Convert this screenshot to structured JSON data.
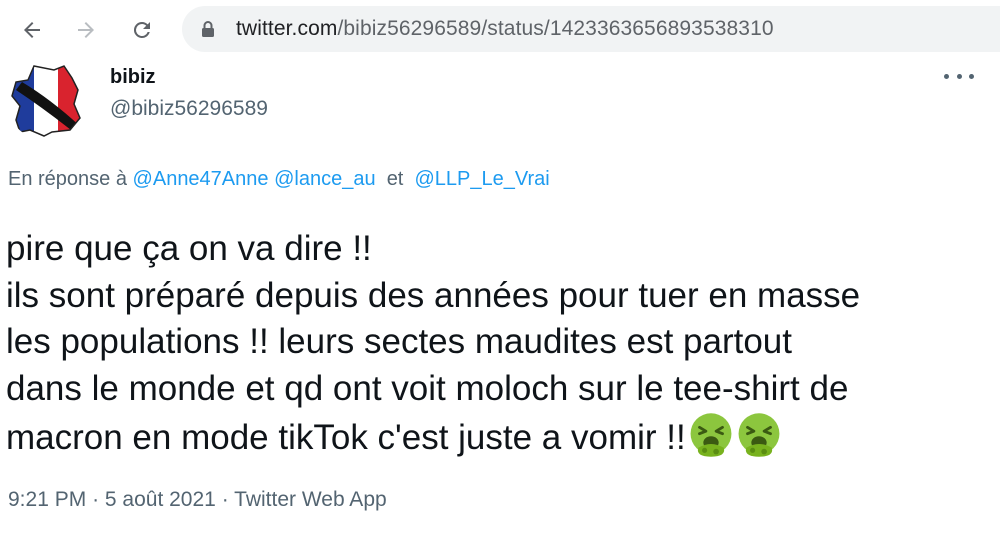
{
  "browser": {
    "url_host": "twitter.com",
    "url_path": "/bibiz56296589/status/1423363656893538310",
    "back_icon": "back-arrow-icon",
    "forward_icon": "forward-arrow-icon",
    "reload_icon": "reload-icon",
    "lock_icon": "lock-icon"
  },
  "tweet": {
    "display_name": "bibiz",
    "handle": "@bibiz56296589",
    "more_icon": "more-options-icon",
    "reply": {
      "prefix": "En réponse à",
      "mentions": [
        "@Anne47Anne",
        "@lance_au"
      ],
      "conjunction": "et",
      "last_mention": "@LLP_Le_Vrai"
    },
    "text_lines": [
      "pire que ça on va dire !!",
      "ils sont préparé depuis des années pour tuer en masse",
      "les populations !! leurs sectes maudites est partout",
      "dans le monde et qd ont voit moloch sur le tee-shirt de",
      "macron en mode tikTok c'est juste a vomir !!"
    ],
    "emojis": [
      "vomiting-face-emoji",
      "vomiting-face-emoji"
    ],
    "time": "9:21 PM",
    "date": "5 août 2021",
    "source": "Twitter Web App",
    "separator": "·"
  },
  "colors": {
    "link": "#1d9bf0",
    "secondary_text": "#536471",
    "primary_text": "#0f1419",
    "omnibox_bg": "#f1f3f4"
  }
}
